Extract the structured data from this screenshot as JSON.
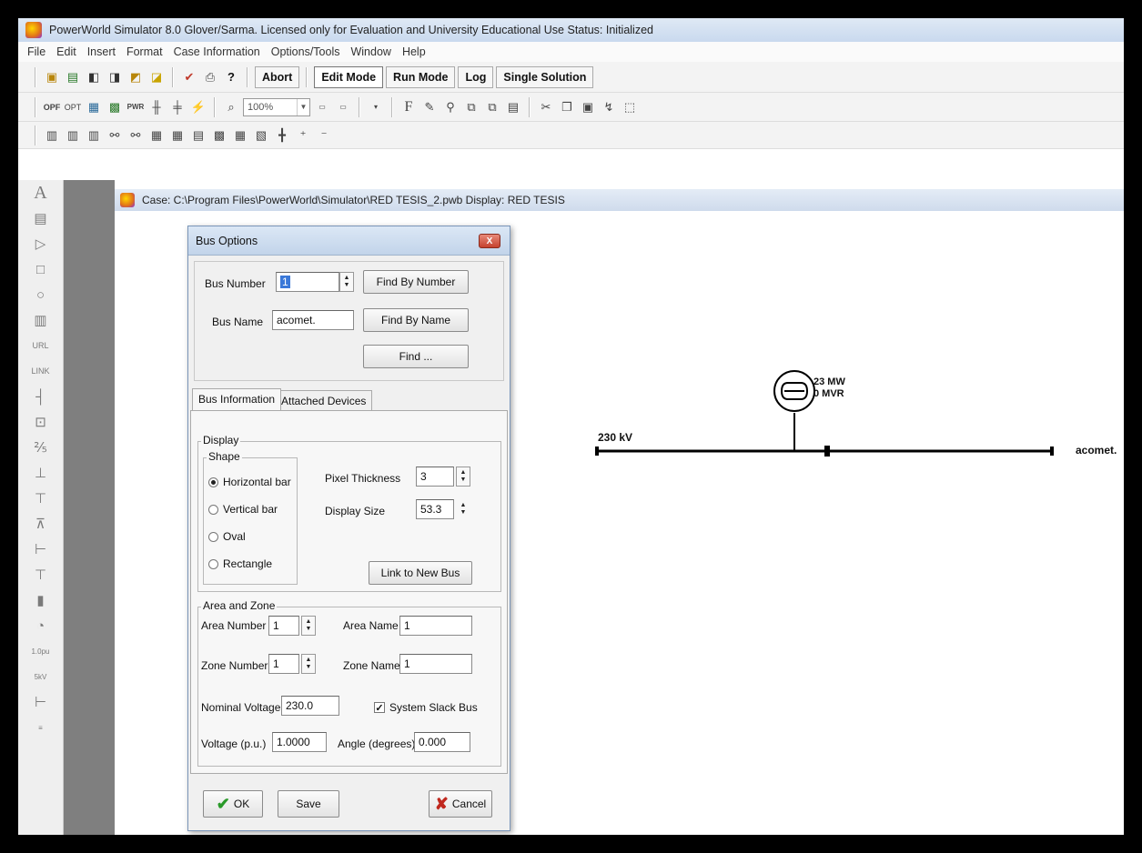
{
  "app": {
    "title": "PowerWorld Simulator 8.0 Glover/Sarma. Licensed only for Evaluation and University Educational Use    Status: Initialized"
  },
  "menu": [
    "File",
    "Edit",
    "Insert",
    "Format",
    "Case Information",
    "Options/Tools",
    "Window",
    "Help"
  ],
  "toolbar1": {
    "buttons": {
      "abort": "Abort",
      "edit_mode": "Edit Mode",
      "run_mode": "Run Mode",
      "log": "Log",
      "single_solution": "Single Solution"
    },
    "icons": [
      "open-case-icon",
      "save-case-icon",
      "open-oneline-icon",
      "save-oneline-icon",
      "close-oneline-icon",
      "scroll-icon",
      "refresh-icon",
      "print-icon",
      "help-icon"
    ]
  },
  "toolbar2": {
    "zoom": "100%",
    "icons": [
      "opf-icon",
      "opt-icon",
      "contingency-icon",
      "quick-pf-icon",
      "area-icon",
      "zone-icon",
      "fill-icon",
      "pan-zoom-icon",
      "save-view-icon",
      "font-icon",
      "line-color-icon",
      "zoom-icon",
      "copy-format-icon",
      "paste-format-icon",
      "auto-draw-icon",
      "cut-icon",
      "copy-icon",
      "paste-icon",
      "connect-icon",
      "select-icon"
    ]
  },
  "toolbar3": {
    "icons": [
      "align-left-icon",
      "align-center-icon",
      "align-right-icon",
      "find-icon",
      "find-next-icon",
      "grid-icon",
      "table-icon",
      "layers-icon",
      "draw-icon",
      "layout-icon",
      "spacing-icon",
      "crosshair-icon",
      "zoom-in-icon",
      "zoom-out-icon"
    ]
  },
  "palette": {
    "icons": [
      "text-icon",
      "note-icon",
      "arrow-icon",
      "rectangle-icon",
      "ellipse-icon",
      "document-icon",
      "url-label-icon",
      "link-label-icon",
      "bus-icon",
      "load-icon",
      "generator-icon",
      "transformer-icon",
      "line-icon",
      "switched-shunt-icon",
      "series-cap-icon",
      "injection-icon",
      "substation-icon",
      "pie-chart-icon",
      "voltage-pu-icon",
      "kv-icon",
      "line-flow-icon",
      "zone-icon-2"
    ],
    "labels": [
      "A",
      "",
      "",
      "",
      "",
      "",
      "URL",
      "LINK",
      "",
      "",
      "",
      "",
      "",
      "",
      "",
      "",
      "",
      "",
      "1.0pu",
      "5kV",
      "",
      ""
    ]
  },
  "child_window": {
    "title": "Case: C:\\Program Files\\PowerWorld\\Simulator\\RED TESIS_2.pwb  Display: RED TESIS"
  },
  "dialog": {
    "title": "Bus Options",
    "close": "X",
    "bus_number_label": "Bus Number",
    "bus_number": "1",
    "bus_name_label": "Bus Name",
    "bus_name": "acomet.",
    "find_by_number": "Find By Number",
    "find_by_name": "Find By Name",
    "find": "Find ...",
    "tabs": [
      "Bus Information",
      "Attached Devices"
    ],
    "display_legend": "Display",
    "shape_legend": "Shape",
    "shapes": [
      "Horizontal bar",
      "Vertical bar",
      "Oval",
      "Rectangle"
    ],
    "selected_shape": "Horizontal bar",
    "pixel_thickness_label": "Pixel Thickness",
    "pixel_thickness": "3",
    "display_size_label": "Display Size",
    "display_size": "53.3",
    "link_to_new_bus": "Link to New Bus",
    "area_zone_legend": "Area and Zone",
    "area_number_label": "Area Number",
    "area_number": "1",
    "area_name_label": "Area Name",
    "area_name": "1",
    "zone_number_label": "Zone Number",
    "zone_number": "1",
    "zone_name_label": "Zone Name",
    "zone_name": "1",
    "nominal_voltage_label": "Nominal Voltage",
    "nominal_voltage": "230.0",
    "slack_label": "System Slack Bus",
    "slack_checked": true,
    "voltage_pu_label": "Voltage (p.u.)",
    "voltage_pu": "1.0000",
    "angle_label": "Angle (degrees)",
    "angle": "0.000",
    "ok": "OK",
    "save": "Save",
    "cancel": "Cancel"
  },
  "oneline": {
    "bus_kv": "230 kV",
    "bus_name": "acomet.",
    "gen_mw": "23 MW",
    "gen_mvr": "0 MVR"
  }
}
